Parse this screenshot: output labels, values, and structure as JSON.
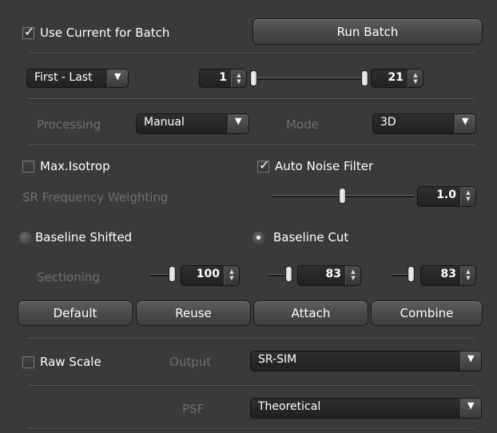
{
  "batch": {
    "use_current_label": "Use Current for Batch",
    "use_current_checked": true,
    "run_label": "Run Batch"
  },
  "range": {
    "mode": "First - Last",
    "from": "1",
    "to": "21"
  },
  "processing": {
    "label": "Processing",
    "value": "Manual",
    "mode_label": "Mode",
    "mode_value": "3D"
  },
  "options": {
    "max_isotrop_label": "Max.Isotrop",
    "max_isotrop_checked": false,
    "auto_noise_label": "Auto Noise Filter",
    "auto_noise_checked": true
  },
  "sr_freq": {
    "label": "SR Frequency Weighting",
    "value": "1.0"
  },
  "baseline": {
    "shifted_label": "Baseline Shifted",
    "cut_label": "Baseline Cut",
    "selected": "cut"
  },
  "sectioning": {
    "label": "Sectioning",
    "values": [
      "100",
      "83",
      "83"
    ]
  },
  "buttons": {
    "default": "Default",
    "reuse": "Reuse",
    "attach": "Attach",
    "combine": "Combine"
  },
  "output": {
    "raw_scale_label": "Raw Scale",
    "raw_scale_checked": false,
    "label": "Output",
    "value": "SR-SIM"
  },
  "psf": {
    "label": "PSF",
    "value": "Theoretical"
  },
  "icons": {
    "check": "check-icon",
    "dropdown": "chevron-down-icon",
    "spin": "spin-arrows-icon"
  }
}
